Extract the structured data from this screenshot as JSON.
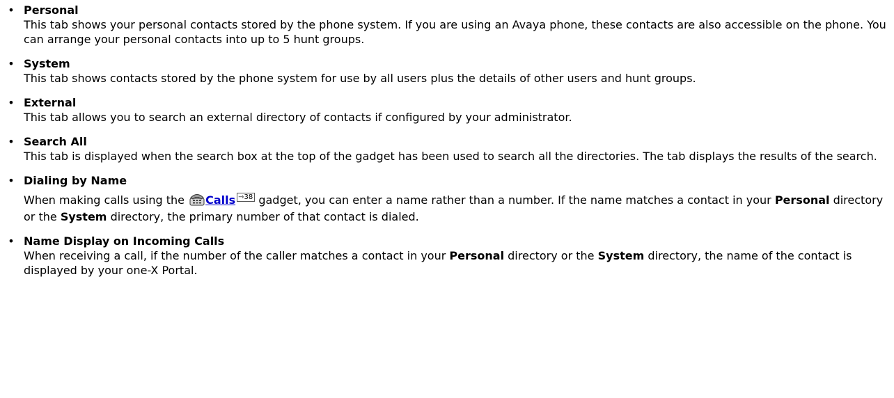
{
  "items": [
    {
      "title": "Personal",
      "desc": "This tab shows your personal contacts stored by the phone system. If you are using an Avaya phone, these contacts are also accessible on the phone. You can arrange your personal contacts into up to 5 hunt groups."
    },
    {
      "title": "System",
      "desc": "This tab shows contacts stored by the phone system for use by all users plus the details of other users and hunt groups."
    },
    {
      "title": "External",
      "desc": "This tab allows you to search an external directory of contacts if configured by your administrator."
    },
    {
      "title": "Search All",
      "desc": "This tab is displayed when the search box at the top of the gadget has been used to search all the directories. The tab displays the results of the search."
    },
    {
      "title": "Dialing by Name",
      "desc_1": "When making calls using the",
      "link": "Calls",
      "page_ref": "38",
      "desc_2": "gadget, you can enter a name rather than a number. If the name matches a contact in your",
      "term_1": "Personal",
      "desc_3": "directory or the",
      "term_2": "System",
      "desc_4": "directory, the primary number of that contact is dialed."
    },
    {
      "title": "Name Display on Incoming Calls",
      "desc_1": "When receiving a call, if the number of the caller matches a contact in your",
      "term_1": "Personal",
      "desc_2": "directory or the",
      "term_2": "System",
      "desc_3": "directory, the name of the contact is displayed by your one-X Portal."
    }
  ],
  "bullet": "•",
  "page_ref_arrow": "⇾",
  "icons": {
    "calls": "phone-icon"
  },
  "colors": {
    "link": "#0000cc",
    "text": "#000000"
  }
}
